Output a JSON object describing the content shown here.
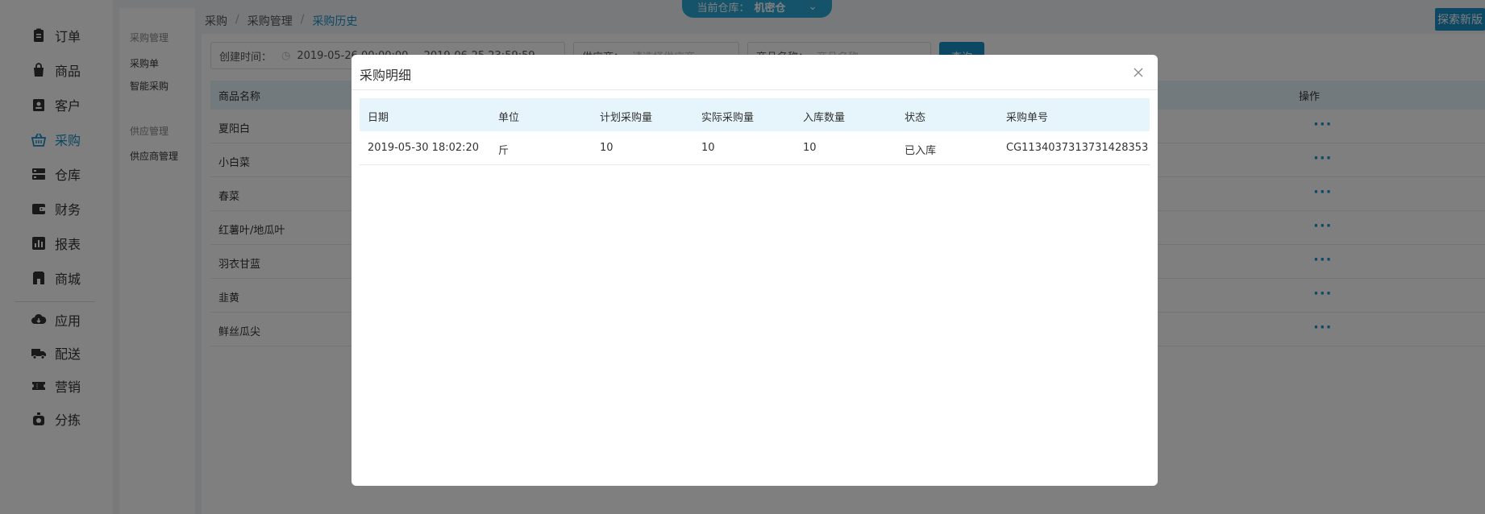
{
  "nav": {
    "items": [
      {
        "label": "订单",
        "icon": "clipboard-icon"
      },
      {
        "label": "商品",
        "icon": "shopping-bag-icon"
      },
      {
        "label": "客户",
        "icon": "customer-card-icon"
      },
      {
        "label": "采购",
        "icon": "basket-icon"
      },
      {
        "label": "仓库",
        "icon": "warehouse-icon"
      },
      {
        "label": "财务",
        "icon": "wallet-icon"
      },
      {
        "label": "报表",
        "icon": "bar-chart-icon"
      },
      {
        "label": "商城",
        "icon": "store-icon"
      },
      {
        "label": "应用",
        "icon": "cloud-download-icon"
      },
      {
        "label": "配送",
        "icon": "truck-icon"
      },
      {
        "label": "营销",
        "icon": "ticket-icon"
      },
      {
        "label": "分拣",
        "icon": "scale-icon"
      }
    ],
    "active": "采购"
  },
  "subnav": {
    "group1": "采购管理",
    "items1": [
      "采购单",
      "智能采购"
    ],
    "group2": "供应管理",
    "items2": [
      "供应商管理"
    ]
  },
  "breadcrumb": {
    "level1": "采购",
    "level2": "采购管理",
    "current": "采购历史",
    "separator": "/"
  },
  "warehouse": {
    "label": "当前仓库：",
    "value": "机密仓"
  },
  "explore_button": "探索新版",
  "filters": {
    "created_label": "创建时间：",
    "created_value": "2019-05-26 00:00:00 ~ 2019-06-25 23:59:59",
    "supplier_label": "供应商：",
    "supplier_placeholder": "请选择供应商",
    "product_label": "商品名称：",
    "product_placeholder": "商品名称",
    "search_button": "查询"
  },
  "table": {
    "col_name": "商品名称",
    "col_action": "操作",
    "rows": [
      "夏阳白",
      "小白菜",
      "春菜",
      "红薯叶/地瓜叶",
      "羽衣甘蓝",
      "韭黄",
      "鲜丝瓜尖"
    ],
    "more_label": "···"
  },
  "modal": {
    "title": "采购明细",
    "headers": [
      "日期",
      "单位",
      "计划采购量",
      "实际采购量",
      "入库数量",
      "状态",
      "采购单号"
    ],
    "rows": [
      [
        "2019-05-30 18:02:20",
        "斤",
        "10",
        "10",
        "10",
        "已入库",
        "CG1134037313731428353"
      ]
    ]
  },
  "colors": {
    "accent": "#1890c8",
    "header_bg": "#e6f4fb",
    "overlay": "rgba(0,0,0,0.5)"
  }
}
